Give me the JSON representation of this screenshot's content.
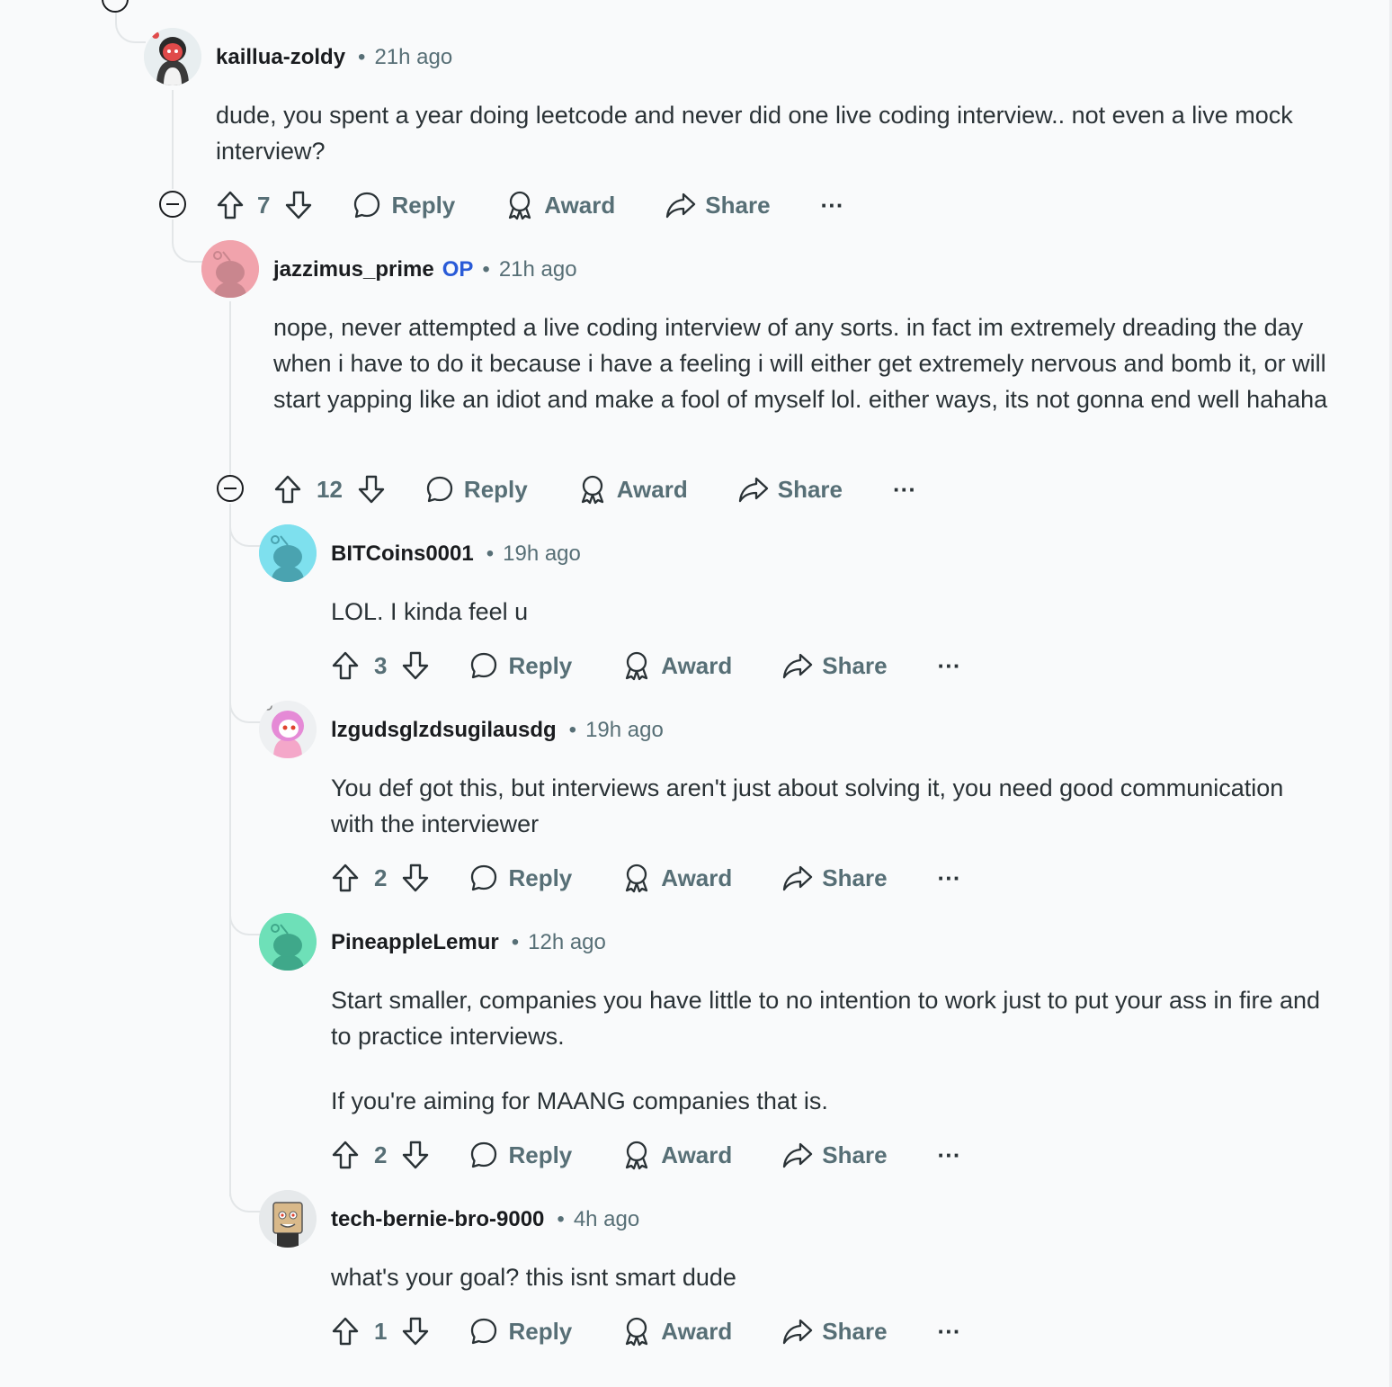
{
  "comments": [
    {
      "author": "kaillua-zoldy",
      "op": "",
      "time": "21h ago",
      "body": [
        "dude, you spent a year doing leetcode and never did one live coding interview.. not even a live mock interview?"
      ],
      "votes": "7",
      "avatar": {
        "bg": "#e8eef0",
        "fg": "#d93a3a",
        "icon": "custom-avatar-icon"
      }
    },
    {
      "author": "jazzimus_prime",
      "op": "OP",
      "time": "21h ago",
      "body": [
        "nope, never attempted a live coding interview of any sorts. in fact im extremely dreading the day when i have to do it because i have a feeling i will either get extremely nervous and bomb it, or will start yapping like an idiot and make a fool of myself lol. either ways, its not gonna end well hahaha"
      ],
      "votes": "12",
      "avatar": {
        "bg": "#f1a3ac",
        "fg": "#c9868e",
        "icon": "snoo-avatar-icon"
      }
    },
    {
      "author": "BITCoins0001",
      "op": "",
      "time": "19h ago",
      "body": [
        "LOL. I kinda feel u"
      ],
      "votes": "3",
      "avatar": {
        "bg": "#7ee0ee",
        "fg": "#4aa3b0",
        "icon": "snoo-avatar-icon"
      }
    },
    {
      "author": "lzgudsglzdsugilausdg",
      "op": "",
      "time": "19h ago",
      "body": [
        "You def got this, but interviews aren't just about solving it, you need good communication with the interviewer"
      ],
      "votes": "2",
      "avatar": {
        "bg": "#eef0f2",
        "fg": "#e58ad6",
        "icon": "custom-avatar-icon"
      }
    },
    {
      "author": "PineappleLemur",
      "op": "",
      "time": "12h ago",
      "body": [
        "Start smaller, companies you have little to no intention to work just to put your ass in fire and to practice interviews.",
        "If you're aiming for MAANG companies that is."
      ],
      "votes": "2",
      "avatar": {
        "bg": "#6ee0b8",
        "fg": "#3fa88a",
        "icon": "snoo-avatar-icon"
      }
    },
    {
      "author": "tech-bernie-bro-9000",
      "op": "",
      "time": "4h ago",
      "body": [
        "what's your goal? this isnt smart dude"
      ],
      "votes": "1",
      "avatar": {
        "bg": "#e6e9eb",
        "fg": "#c9a978",
        "icon": "custom-avatar-icon"
      }
    }
  ],
  "labels": {
    "reply": "Reply",
    "award": "Award",
    "share": "Share",
    "more": "···"
  },
  "colors": {
    "background": "#f9fafb",
    "thread_line": "#e3e6e8",
    "op_badge": "#2a5bd7",
    "meta_text": "#576f76"
  }
}
